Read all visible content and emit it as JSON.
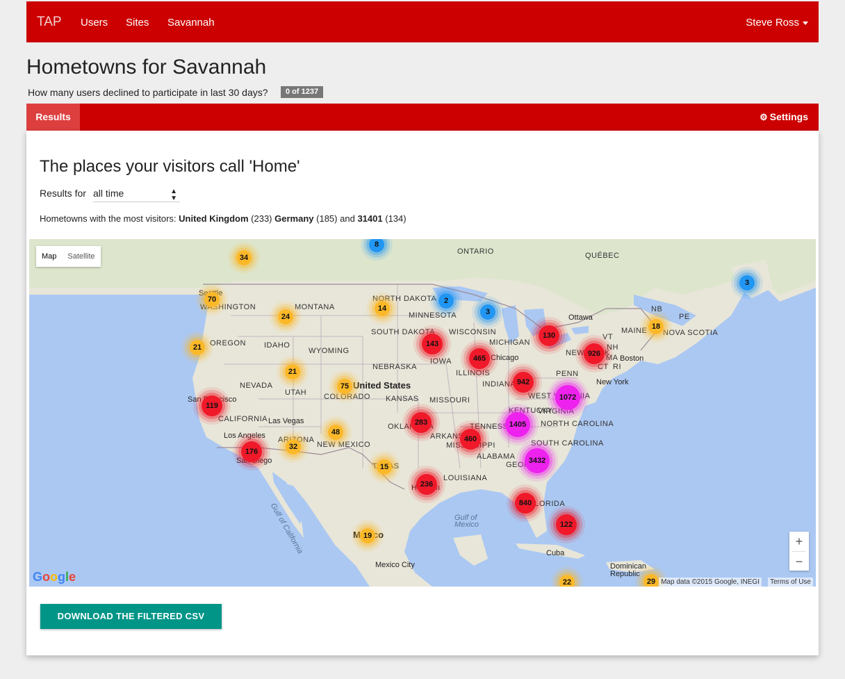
{
  "nav": {
    "brand": "TAP",
    "links": [
      "Users",
      "Sites",
      "Savannah"
    ],
    "user": "Steve Ross"
  },
  "page": {
    "title": "Hometowns for Savannah",
    "declined_question": "How many users declined to participate in last 30 days?",
    "declined_badge": "0 of 1237"
  },
  "tabs": {
    "results": "Results",
    "settings": "Settings"
  },
  "card": {
    "heading": "The places your visitors call 'Home'",
    "results_for_label": "Results for",
    "results_for_value": "all time",
    "top_prefix": "Hometowns with the most visitors:",
    "top": [
      {
        "name": "United Kingdom",
        "count": "(233)"
      },
      {
        "name": "Germany",
        "count": "(185)"
      },
      {
        "name": "31401",
        "count": "(134)"
      }
    ],
    "top_joiner": "and",
    "download_label": "DOWNLOAD THE FILTERED CSV"
  },
  "map": {
    "type_buttons": [
      "Map",
      "Satellite"
    ],
    "zoom_in": "+",
    "zoom_out": "−",
    "logo": "Google",
    "attribution": "Map data ©2015 Google, INEGI",
    "terms": "Terms of Use",
    "colors": {
      "blue": "#2196f3",
      "yellow": "#fbb829",
      "red": "#f0192a",
      "magenta": "#ee22ee",
      "land": "#e6e3d6",
      "water": "#abc8f2"
    },
    "labels": [
      "ONTARIO",
      "QUÉBEC",
      "NB",
      "PE",
      "NOVA SCOTIA",
      "MAINE",
      "VT",
      "NH",
      "MA",
      "CT",
      "RI",
      "Boston",
      "New York",
      "PENN",
      "NEW YORK",
      "Ottawa",
      "MICHIGAN",
      "WISCONSIN",
      "MINNESOTA",
      "NORTH DAKOTA",
      "SOUTH DAKOTA",
      "MONTANA",
      "WASHINGTON",
      "Seattle",
      "OREGON",
      "IDAHO",
      "WYOMING",
      "NEBRASKA",
      "IOWA",
      "ILLINOIS",
      "INDIANA",
      "Chicago",
      "NEVADA",
      "UTAH",
      "COLORADO",
      "United States",
      "KANSAS",
      "MISSOURI",
      "KENTUCKY",
      "WEST VIRGINIA",
      "VIRGINIA",
      "NORTH CAROLINA",
      "SOUTH CAROLINA",
      "TENNESSEE",
      "ARKANSAS",
      "MISSISSIPPI",
      "ALABAMA",
      "GEORGIA",
      "OKLAHOMA",
      "TEXAS",
      "NEW MEXICO",
      "ARIZONA",
      "CALIFORNIA",
      "San Francisco",
      "Las Vegas",
      "Los Angeles",
      "San Diego",
      "LOUISIANA",
      "Houston",
      "FLORIDA",
      "Gulf of California",
      "Gulf of Mexico",
      "Mexico",
      "Mexico City",
      "Cuba",
      "Dominican Republic"
    ],
    "clusters": [
      {
        "count": "8",
        "level": "blue"
      },
      {
        "count": "34",
        "level": "yellow"
      },
      {
        "count": "70",
        "level": "yellow"
      },
      {
        "count": "14",
        "level": "yellow"
      },
      {
        "count": "2",
        "level": "blue"
      },
      {
        "count": "3",
        "level": "blue"
      },
      {
        "count": "3",
        "level": "blue"
      },
      {
        "count": "24",
        "level": "yellow"
      },
      {
        "count": "21",
        "level": "yellow"
      },
      {
        "count": "143",
        "level": "red"
      },
      {
        "count": "130",
        "level": "red"
      },
      {
        "count": "18",
        "level": "yellow"
      },
      {
        "count": "465",
        "level": "red"
      },
      {
        "count": "926",
        "level": "red"
      },
      {
        "count": "21",
        "level": "yellow"
      },
      {
        "count": "75",
        "level": "yellow"
      },
      {
        "count": "942",
        "level": "red"
      },
      {
        "count": "1072",
        "level": "magenta"
      },
      {
        "count": "119",
        "level": "red"
      },
      {
        "count": "283",
        "level": "red"
      },
      {
        "count": "1405",
        "level": "magenta"
      },
      {
        "count": "48",
        "level": "yellow"
      },
      {
        "count": "32",
        "level": "yellow"
      },
      {
        "count": "176",
        "level": "red"
      },
      {
        "count": "460",
        "level": "red"
      },
      {
        "count": "3432",
        "level": "magenta"
      },
      {
        "count": "15",
        "level": "yellow"
      },
      {
        "count": "236",
        "level": "red"
      },
      {
        "count": "840",
        "level": "red"
      },
      {
        "count": "122",
        "level": "red"
      },
      {
        "count": "19",
        "level": "yellow"
      },
      {
        "count": "22",
        "level": "yellow"
      },
      {
        "count": "29",
        "level": "yellow"
      }
    ]
  }
}
